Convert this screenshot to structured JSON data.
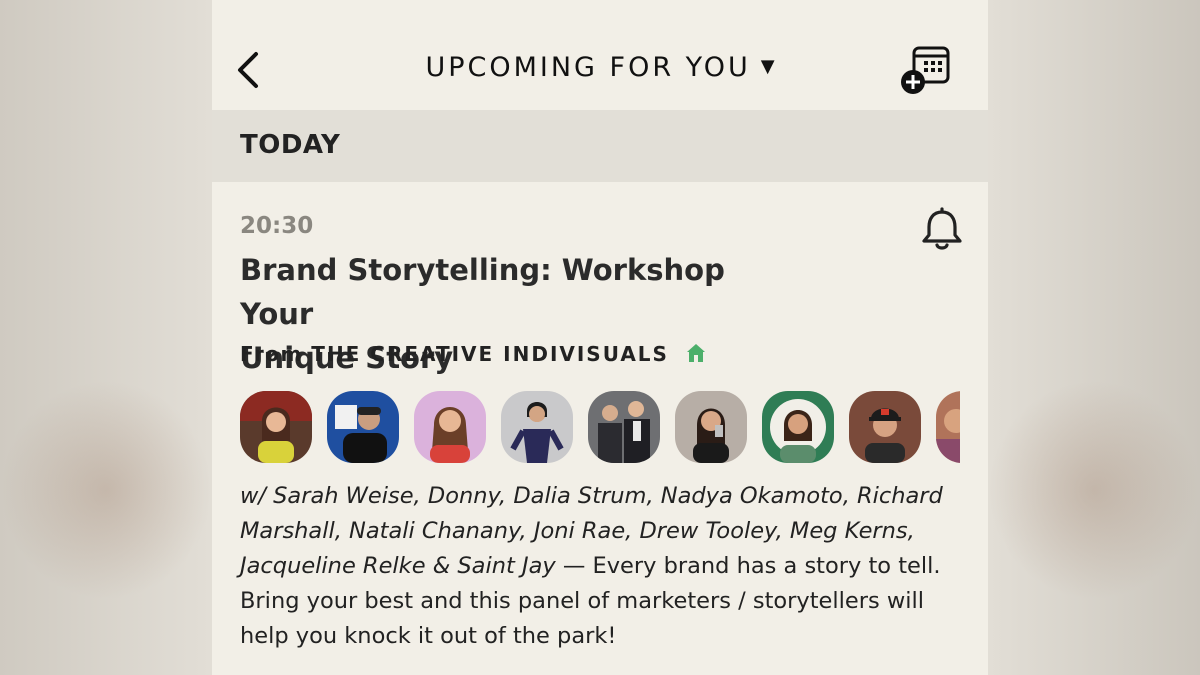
{
  "header": {
    "title": "UPCOMING FOR YOU",
    "title_caret": "▼",
    "back_icon": "chevron-left-icon",
    "calendar_icon": "calendar-add-icon"
  },
  "section": {
    "label": "TODAY"
  },
  "event": {
    "time": "20:30",
    "title_line1": "Brand Storytelling: Workshop Your",
    "title_line2": "Unique Story",
    "from_prefix": "From",
    "club_name": "THE CREATIVE INDIVISUALS",
    "club_icon": "house-icon",
    "bell_icon": "bell-icon",
    "speakers_text": "w/ Sarah Weise, Donny, Dalia Strum, Nadya Okamoto, Richard Marshall, Natali Chanany, Joni Rae, Drew Tooley, Meg Kerns, Jacqueline Relke & Saint Jay",
    "description": " — Every brand has a story to tell. Bring your best and this panel of marketers / storytellers will help you knock it out of the park!",
    "avatars": [
      "avatar-1",
      "avatar-2",
      "avatar-3",
      "avatar-4",
      "avatar-5",
      "avatar-6",
      "avatar-7",
      "avatar-8",
      "avatar-9"
    ]
  },
  "colors": {
    "background": "#f2efe7",
    "section_bar": "#e2dfd7",
    "time_text": "#8a8780",
    "club_house_green": "#4caf6a"
  }
}
